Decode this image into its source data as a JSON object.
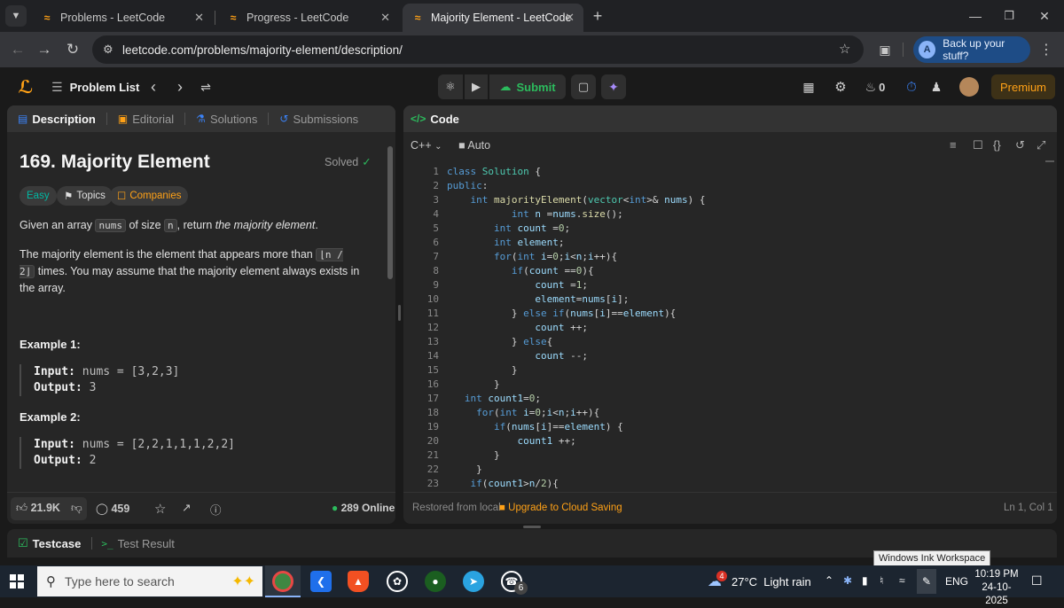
{
  "browser": {
    "tabs": [
      {
        "title": "Problems - LeetCode"
      },
      {
        "title": "Progress - LeetCode"
      },
      {
        "title": "Majority Element - LeetCode"
      }
    ],
    "url": "leetcode.com/problems/majority-element/description/",
    "profile_label": "Back up your stuff?",
    "profile_initial": "A"
  },
  "lcnav": {
    "problem_list": "Problem List",
    "submit": "Submit",
    "streak": "0",
    "premium": "Premium"
  },
  "left_panel": {
    "tabs": [
      "Description",
      "Editorial",
      "Solutions",
      "Submissions"
    ],
    "title": "169. Majority Element",
    "status": "Solved",
    "chips": [
      "Easy",
      "Topics",
      "Companies"
    ],
    "desc1": {
      "a": "Given an array ",
      "b": "nums",
      "c": " of size ",
      "d": "n",
      "e": ", return ",
      "f": "the majority element",
      "g": "."
    },
    "desc2": {
      "a": "The majority element is the element that appears more than ",
      "b": "⌊n / 2⌋",
      "c": " times. You may assume that the majority element always exists in the array."
    },
    "examples": [
      {
        "head": "Example 1:",
        "input_label": "Input:",
        "input": "nums = [3,2,3]",
        "output_label": "Output:",
        "output": "3"
      },
      {
        "head": "Example 2:",
        "input_label": "Input:",
        "input": "nums = [2,2,1,1,1,2,2]",
        "output_label": "Output:",
        "output": "2"
      }
    ],
    "likes": "21.9K",
    "comments": "459",
    "online": "289 Online"
  },
  "right_panel": {
    "title": "Code",
    "language": "C++",
    "mode": "Auto",
    "footer_left": "Restored from local",
    "footer_link": "Upgrade to Cloud Saving",
    "cursor": "Ln 1, Col 1"
  },
  "testbar": {
    "testcase": "Testcase",
    "result": "Test Result"
  },
  "taskbar": {
    "search_placeholder": "Type here to search",
    "weather_temp": "27°C",
    "weather_desc": "Light rain",
    "lang": "ENG",
    "time": "10:19 PM",
    "date": "24-10-2025",
    "tooltip": "Windows Ink Workspace",
    "weather_badge": "4",
    "whatsapp_badge": "6"
  },
  "colors": {
    "accent": "#ffa116",
    "success": "#2cbb5d",
    "easy": "#00b8a3"
  }
}
